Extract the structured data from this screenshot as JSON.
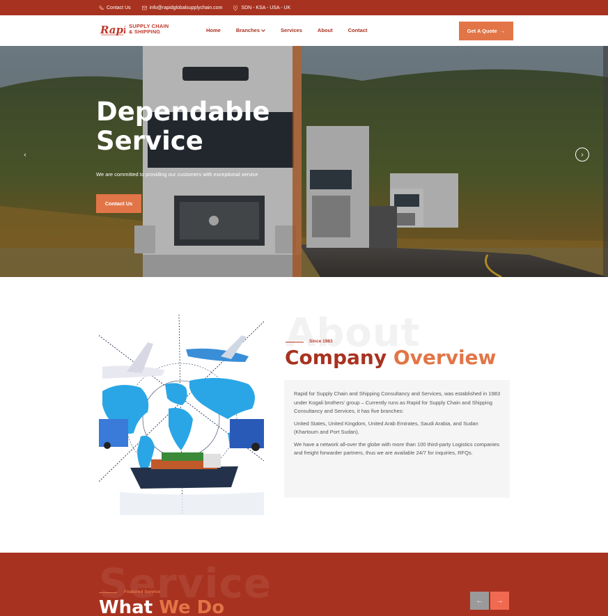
{
  "topbar": {
    "contact": "Contact Us",
    "email": "info@rapidglobalsupplychain.com",
    "locations": "SDN - KSA - USA - UK"
  },
  "header": {
    "logo_text": "Rapid",
    "logo_line1": "SUPPLY CHAIN",
    "logo_line2": "& SHIPPING",
    "nav": [
      "Home",
      "Branches",
      "Services",
      "About",
      "Contact"
    ],
    "quote_button": "Get A Quote",
    "quote_arrow": "→"
  },
  "hero": {
    "title_line1": "Dependable",
    "title_line2": "Service",
    "subtitle": "We are committed to providing our customers with exceptional service",
    "button": "Contact Us",
    "prev_arrow": "‹",
    "next_arrow": "›"
  },
  "about": {
    "bg_word": "About",
    "since": "Since 1983",
    "heading_part1": "Company",
    "heading_part2": "Overview",
    "paragraphs": [
      "Rapid for Supply Chain and Shipping Consultancy and Services, was established in 1983 under Kogali brothers' group – Currently runs as Rapid for Supply Chain and Shipping Consultancy and Services, it has five branches:",
      "United States, United Kingdom, United Arab Emirates, Saudi Arabia, and Sudan (Khartoum and Port Sudan).",
      "We have a network all-over the globe with more than 100 third-party Logistics companies and freight forwarder partners, thus we are available 24/7 for inquiries, RFQs."
    ]
  },
  "services": {
    "bg_word": "Service",
    "featured": "Featured Service",
    "heading_part1": "What",
    "heading_part2": "We Do",
    "prev_arrow": "←",
    "next_arrow": "→"
  },
  "colors": {
    "brand_dark": "#a83220",
    "brand_accent": "#e27547"
  }
}
